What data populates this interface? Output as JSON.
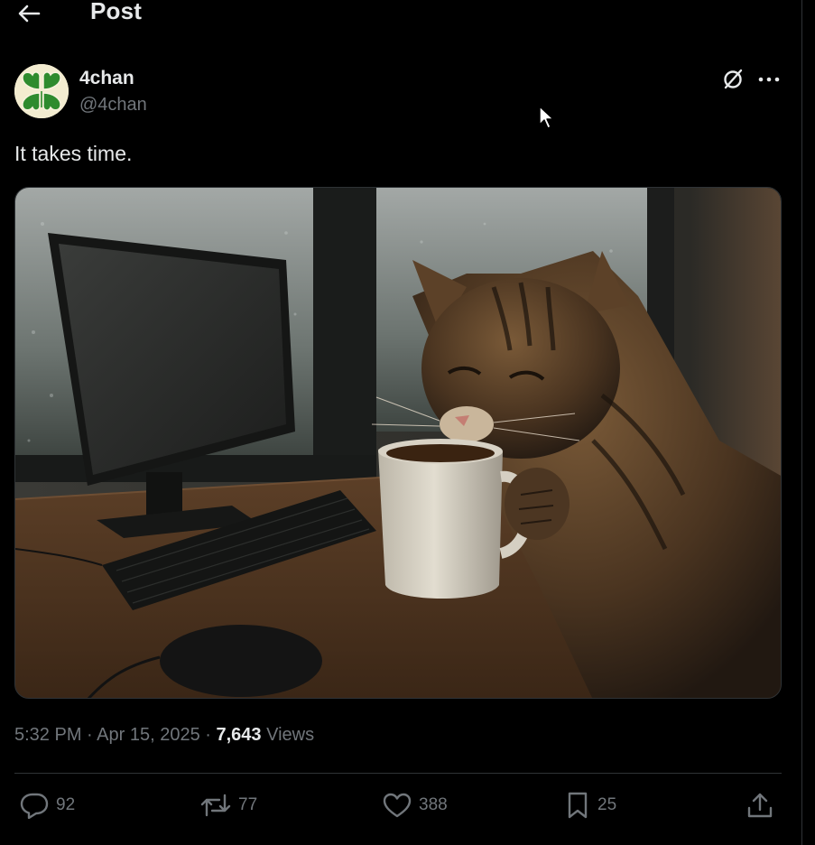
{
  "header": {
    "title": "Post",
    "back_icon": "arrow-left-icon"
  },
  "author": {
    "display_name": "4chan",
    "handle": "@4chan",
    "avatar_icon": "four-leaf-clover-icon"
  },
  "post": {
    "text": "It takes time.",
    "media_alt": "Photo of a tabby cat sipping from a white coffee mug at a desk with a monitor, keyboard and mouse beside a rainy window"
  },
  "meta": {
    "time": "5:32 PM",
    "date": "Apr 15, 2025",
    "separator": " · ",
    "views_count": "7,643",
    "views_label": "Views"
  },
  "actions": {
    "replies": "92",
    "reposts": "77",
    "likes": "388",
    "bookmarks": "25"
  },
  "icons": {
    "grok": "slashed-circle-icon",
    "more": "more-dots-icon",
    "reply": "speech-bubble-icon",
    "repost": "repost-arrows-icon",
    "like": "heart-icon",
    "bookmark": "bookmark-icon",
    "share": "share-upload-icon"
  },
  "colors": {
    "background": "#000000",
    "text_primary": "#e7e9ea",
    "text_secondary": "#71767b",
    "border": "#2f3336",
    "clover_green": "#2e8b2e"
  }
}
